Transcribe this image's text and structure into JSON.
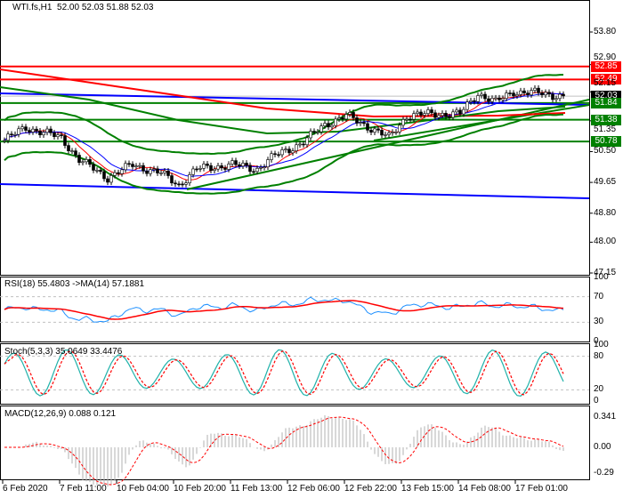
{
  "header": {
    "symbol_label": "WTI.fs,H1",
    "ohlc": "52.00 52.03 51.88 52.03"
  },
  "price_axis": {
    "ticks": [
      "53.80",
      "50.50",
      "49.65",
      "48.80",
      "48.00",
      "47.15"
    ],
    "hidden_ticks": [
      "52.90",
      "52.15",
      "51.35"
    ]
  },
  "levels": [
    {
      "price": 52.85,
      "label": "52.85",
      "color": "#ff0000"
    },
    {
      "price": 52.49,
      "label": "52.49",
      "color": "#ff0000"
    },
    {
      "price": 52.03,
      "label": "52.03",
      "color": "#000000"
    },
    {
      "price": 51.84,
      "label": "51.84",
      "color": "#008000"
    },
    {
      "price": 51.38,
      "label": "51.38",
      "color": "#008000"
    },
    {
      "price": 50.78,
      "label": "50.78",
      "color": "#008000"
    }
  ],
  "rsi": {
    "label": "RSI(18) 55.4803  ->MA(14) 57.1881",
    "ticks": [
      "100",
      "70",
      "30",
      "0"
    ]
  },
  "stoch": {
    "label": "Stoch(5,3,3) 35.0649 33.4476",
    "ticks": [
      "100",
      "80",
      "20",
      "0"
    ]
  },
  "macd": {
    "label": "MACD(12,26,9) 0.088 0.121",
    "ticks": [
      "0.341",
      "0.00",
      "-0.29"
    ]
  },
  "time_axis": [
    "6 Feb 2020",
    "7 Feb 11:00",
    "10 Feb 04:00",
    "10 Feb 20:00",
    "11 Feb 13:00",
    "12 Feb 06:00",
    "12 Feb 22:00",
    "13 Feb 15:00",
    "14 Feb 08:00",
    "17 Feb 01:00"
  ],
  "chart_data": {
    "type": "line",
    "title": "WTI.fs,H1",
    "ylim": [
      47.15,
      54.3
    ],
    "close_waypoints": [
      [
        0,
        50.81
      ],
      [
        6,
        51.17
      ],
      [
        16,
        50.88
      ],
      [
        21,
        50.27
      ],
      [
        29,
        49.78
      ],
      [
        36,
        50.14
      ],
      [
        44,
        49.9
      ],
      [
        49,
        49.58
      ],
      [
        54,
        50.02
      ],
      [
        64,
        50.14
      ],
      [
        71,
        50.02
      ],
      [
        76,
        50.39
      ],
      [
        84,
        50.76
      ],
      [
        90,
        51.25
      ],
      [
        96,
        51.49
      ],
      [
        101,
        51.25
      ],
      [
        108,
        50.88
      ],
      [
        113,
        51.49
      ],
      [
        120,
        51.54
      ],
      [
        128,
        51.54
      ],
      [
        133,
        52.11
      ],
      [
        138,
        51.86
      ],
      [
        143,
        52.16
      ],
      [
        150,
        52.11
      ],
      [
        157,
        52.03
      ]
    ],
    "colors": {
      "up_series": "#1e90ff",
      "ma": "#ff0000",
      "stoch_main": "#20b2aa",
      "bands": "#008000",
      "trend": "#0000ff"
    }
  }
}
